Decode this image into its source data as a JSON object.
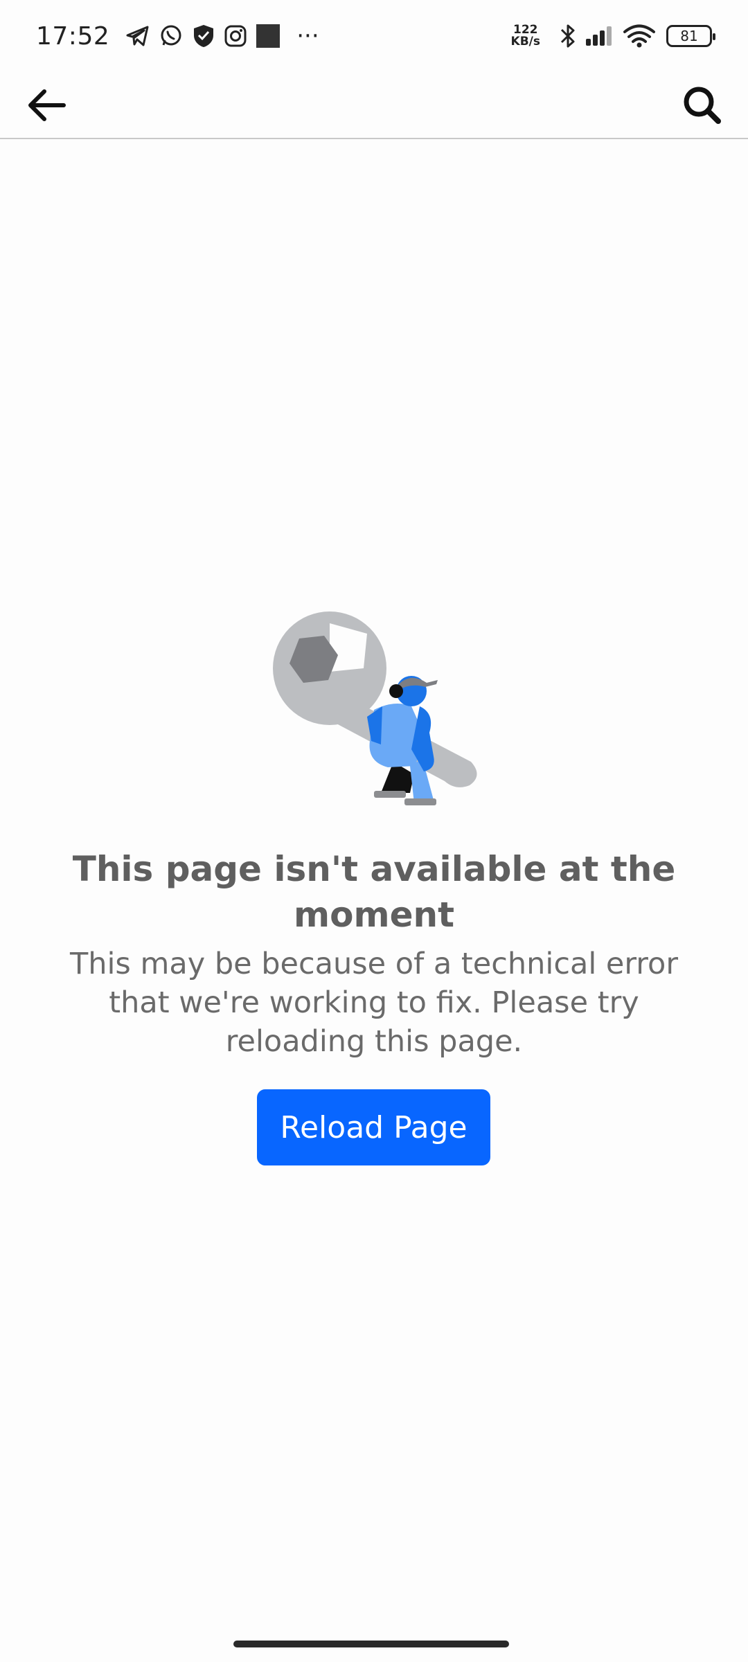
{
  "status_bar": {
    "time": "17:52",
    "net_speed_value": "122",
    "net_speed_unit": "KB/s",
    "battery": "81",
    "overflow": "···",
    "notification_icons": [
      "telegram-icon",
      "whatsapp-icon",
      "shield-icon",
      "instagram-icon",
      "square-icon"
    ],
    "system_icons": [
      "bluetooth-icon",
      "signal-icon",
      "wifi-icon",
      "battery-icon"
    ]
  },
  "app_bar": {
    "back_icon": "arrow-left-icon",
    "search_icon": "search-icon"
  },
  "error": {
    "title": "This page isn't available at the moment",
    "message": "This may be because of a technical error that we're working to fix. Please try reloading this page.",
    "illustration": "person-carrying-wrench"
  },
  "actions": {
    "reload_label": "Reload Page"
  },
  "colors": {
    "primary": "#0866ff",
    "title_text": "#5f5f5f",
    "body_text": "#6a6a6a",
    "divider": "#c8c8c8",
    "wrench": "#bcbec1",
    "figure_blue": "#1b74e8",
    "figure_light_blue": "#6aa9f6"
  }
}
